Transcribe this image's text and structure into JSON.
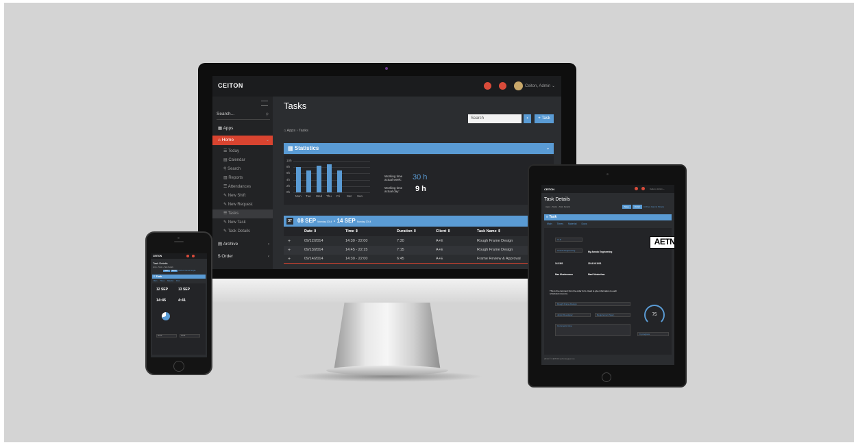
{
  "desktop": {
    "app": {
      "logo": "CEITON",
      "user": "Ceiton, Admin ⌄"
    },
    "sidebar": {
      "search_placeholder": "Search...",
      "items": [
        {
          "label": "Apps"
        },
        {
          "label": "Home"
        },
        {
          "label": "Archive"
        },
        {
          "label": "Order"
        }
      ],
      "sub_items": [
        {
          "label": "Today"
        },
        {
          "label": "Calendar"
        },
        {
          "label": "Search"
        },
        {
          "label": "Reports"
        },
        {
          "label": "Attendances"
        },
        {
          "label": "New Shift"
        },
        {
          "label": "New Request"
        },
        {
          "label": "Tasks"
        },
        {
          "label": "New Task"
        },
        {
          "label": "Task Details"
        }
      ]
    },
    "page": {
      "title": "Tasks",
      "search_value": "Search",
      "task_button": "+ Task",
      "breadcrumb": "Apps  ›  Tasks"
    },
    "statistics": {
      "title": "Statistics",
      "working_week_label": "Working time actual week:",
      "working_week_value": "30 h",
      "working_day_label": "Working time actual day:",
      "working_day_value": "9 h"
    },
    "chart_data": {
      "type": "bar",
      "categories": [
        "Mon",
        "Tue",
        "Wed",
        "Thu",
        "Fri",
        "Sat",
        "Sun"
      ],
      "values": [
        8,
        7,
        8.5,
        9,
        7,
        0,
        0
      ],
      "y_ticks": [
        "10h",
        "8h",
        "6h",
        "4h",
        "2h",
        "0h"
      ],
      "ylim": [
        0,
        10
      ],
      "title": "",
      "xlabel": "",
      "ylabel": ""
    },
    "week": {
      "number": "37",
      "from": "08 SEP",
      "from_sub": "Monday 2014",
      "sep": " - ",
      "to": "14 SEP",
      "to_sub": "Sunday 2014"
    },
    "table": {
      "headers": [
        "Date ⇕",
        "Time ⇕",
        "Duration ⇕",
        "Client ⇕",
        "Task Name ⇕"
      ],
      "rows": [
        {
          "date": "09/12/2014",
          "time": "14:30 - 22:00",
          "duration": "7:30",
          "client": "A+E",
          "task": "Rough Frame Design"
        },
        {
          "date": "09/13/2014",
          "time": "14:45 - 22:15",
          "duration": "7:15",
          "client": "A+E",
          "task": "Rough Frame Design"
        },
        {
          "date": "09/14/2014",
          "time": "14:30 - 22:00",
          "duration": "6:45",
          "client": "A+E",
          "task": "Frame Review & Approval"
        }
      ]
    }
  },
  "tablet": {
    "logo": "CEITON",
    "user": "Ceiton, Admin ⌄",
    "title": "Task Details",
    "breadcrumb": "Apps  ›  Tasks  ›  Task Details",
    "buttons": [
      "Save",
      "Finish",
      "Archive",
      "Cancel",
      "Simple"
    ],
    "panel": "Task",
    "tabs": [
      "Main",
      "Times",
      "Material",
      "Docs"
    ],
    "client_field": "A+E",
    "company_field": "Amedo Engineering",
    "company_value": "My Amedo Engineering",
    "field_a": "14.3361",
    "field_b": "2014.09.1001",
    "person_a": "Max Mustermann",
    "person_b": "Maxi Musterfrau",
    "comment": "This is the comment from the order form. Used to give information to each scheduled resource.",
    "task_field": "Rough Frame Design",
    "junior_field": "Junior Developer",
    "req_field": "Requirement Spec.",
    "comments_field": "Comments Give",
    "gauge_value": "75",
    "status_field": "In progress",
    "brand_logo": "AETN",
    "footer": "2014 © CEITON technologies Inc."
  },
  "phone": {
    "logo": "CEITON",
    "title": "Task Details",
    "breadcrumb": "Apps  ›  Tasks  ›  Task Details",
    "buttons": [
      "Save",
      "Finish",
      "Archive",
      "Cancel",
      "Simple"
    ],
    "panel": "Task",
    "tabs": [
      "Main",
      "Times",
      "Material",
      "Docs"
    ],
    "date_from": "12 SEP",
    "date_to": "13 SEP",
    "time_from": "14:45",
    "time_to": "4:41",
    "field_a": "00:00",
    "field_b": "03:06"
  }
}
